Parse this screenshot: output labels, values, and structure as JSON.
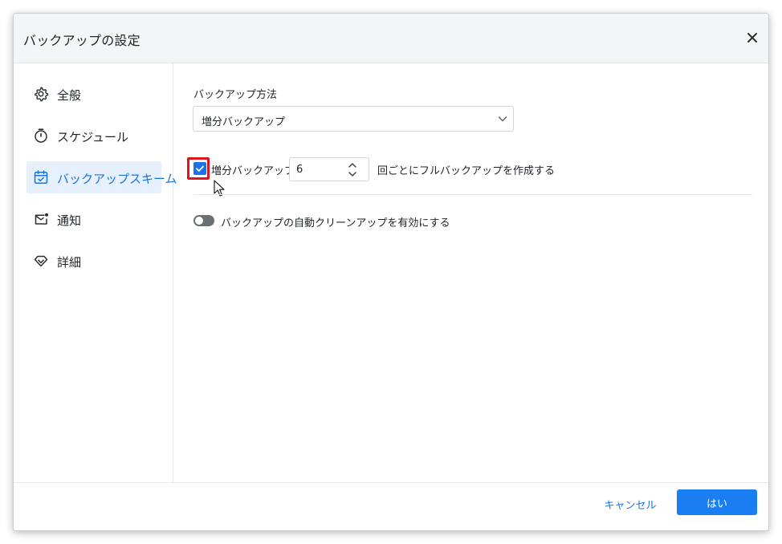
{
  "dialog": {
    "title": "バックアップの設定",
    "close_icon": "close-icon"
  },
  "sidebar": {
    "items": [
      {
        "label": "全般",
        "icon": "gear-icon",
        "active": false
      },
      {
        "label": "スケジュール",
        "icon": "stopwatch-icon",
        "active": false
      },
      {
        "label": "バックアップスキーム",
        "icon": "calendar-check-icon",
        "active": true
      },
      {
        "label": "通知",
        "icon": "mail-notification-icon",
        "active": false
      },
      {
        "label": "詳細",
        "icon": "diamond-icon",
        "active": false
      }
    ]
  },
  "main": {
    "method_label": "バックアップ方法",
    "method_select": {
      "value": "増分バックアップ"
    },
    "incremental": {
      "checked": true,
      "label": "増分バックアップ",
      "count": "6",
      "suffix": "回ごとにフルバックアップを作成する"
    },
    "cleanup_toggle": {
      "enabled": false,
      "label": "バックアップの自動クリーンアップを有効にする"
    }
  },
  "footer": {
    "cancel_label": "キャンセル",
    "ok_label": "はい"
  },
  "colors": {
    "accent": "#1a73e8",
    "primary_button": "#1a7ef2",
    "active_nav_bg": "#e7f1fd",
    "highlight_outline": "#e0141e",
    "toggle_off": "#6b6f76"
  }
}
